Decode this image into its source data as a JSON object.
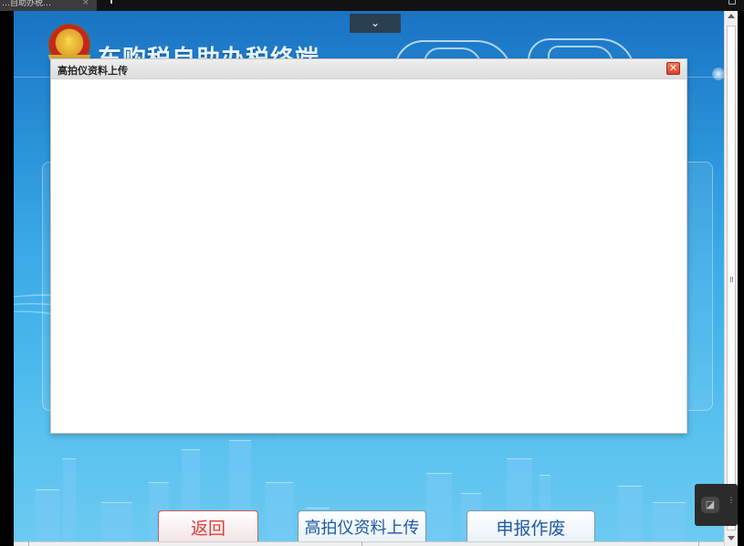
{
  "browser": {
    "tab_label": "…自助办税…",
    "tab_close": "×"
  },
  "kiosk": {
    "title": "车购税自助办税终端",
    "collapse_icon": "chevron-down-icon",
    "collapse_glyph": "⌄",
    "emblem_icon": "national-emblem-icon",
    "buttons": {
      "back_label": "返回",
      "upload_label": "高拍仪资料上传",
      "void_label": "申报作废"
    },
    "colors": {
      "back_text": "#e23b35",
      "primary_text": "#1c5aa0"
    }
  },
  "dialog": {
    "title": "高拍仪资料上传",
    "close_glyph": "✕",
    "close_icon": "close-icon"
  },
  "float_widget": {
    "icon": "assistant-icon",
    "glyph": "◪",
    "dots": "⋮"
  }
}
